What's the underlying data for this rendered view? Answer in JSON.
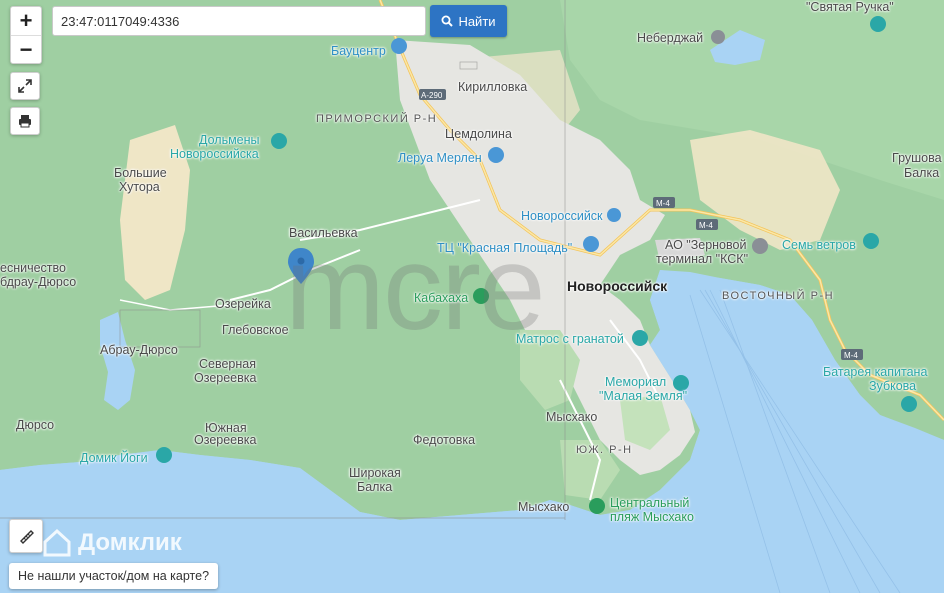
{
  "search": {
    "value": "23:47:0117049:4336",
    "button_label": "Найти"
  },
  "controls": {
    "zoom_in": "+",
    "zoom_out": "−"
  },
  "footer": {
    "not_found": "Не нашли участок/дом на карте?",
    "brand": "Домклик"
  },
  "watermark": "mcre",
  "map_labels": {
    "svyataya_ruchka": "\"Святая Ручка\"",
    "neberdzhay": "Неберджай",
    "baucentr": "Бауцентр",
    "a290": "А-290",
    "kirillovka": "Кирилловка",
    "primorsky": "ПРИМОРСКИЙ Р-Н",
    "tsemdolina": "Цемдолина",
    "dolmeny1": "Дольмены",
    "dolmeny2": "Новороссийска",
    "leroy": "Леруа Мерлен",
    "bolshie1": "Большие",
    "bolshie2": "Хутора",
    "grushovaya1": "Грушова",
    "grushovaya2": "Балка",
    "novoross_station": "Новороссийск",
    "m4a": "М-4",
    "m4b": "М-4",
    "m4c": "М-4",
    "zernovoy1": "АО \"Зерновой",
    "zernovoy2": "терминал \"КСК\"",
    "sem_vetrov": "Семь ветров",
    "vasilevka": "Васильевка",
    "tc_kr": "ТЦ \"Красная Площадь\"",
    "lesnichestvo1": "есничество",
    "lesnichestvo2": "бдрау-Дюрсо",
    "novorossiysk": "Новороссийск",
    "kabahaha": "Кабахаха",
    "ozereyka": "Озерейка",
    "vostochny": "ВОСТОЧНЫЙ Р-Н",
    "glebovskoe": "Глебовское",
    "matros": "Матрос с гранатой",
    "abrau": "Абрау-Дюрсо",
    "severnaya1": "Северная",
    "severnaya2": "Озереевка",
    "batareya1": "Батарея капитана",
    "batareya2": "Зубкова",
    "memorial1": "Мемориал",
    "memorial2": "\"Малая Земля\"",
    "myshako1": "Мысхако",
    "durso": "Дюрсо",
    "yuzhnaya1": "Южная",
    "yuzhnaya2": "Озереевка",
    "domik": "Домик Йоги",
    "fedotovka": "Федотовка",
    "yuzh_rn": "ЮЖ. Р-Н",
    "shirokaya1": "Широкая",
    "shirokaya2": "Балка",
    "myshako2": "Мысхако",
    "plyazh1": "Центральный",
    "plyazh2": "пляж Мысхако"
  },
  "colors": {
    "sea": "#a9d3f4",
    "forest": "#8fc79b",
    "urban": "#e6e6e2",
    "button": "#2d74c4"
  }
}
